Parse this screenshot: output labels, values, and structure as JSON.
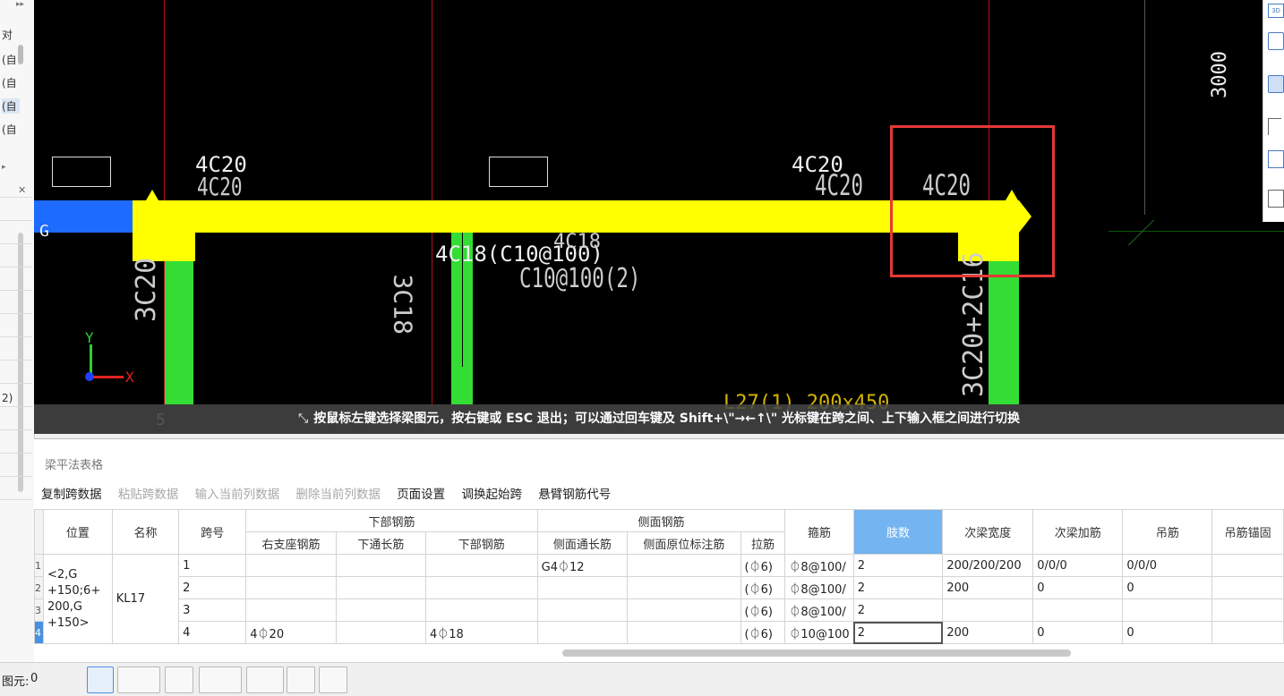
{
  "left_panel": {
    "items": [
      "对",
      "(自",
      "(自",
      "(自",
      "(自"
    ],
    "side_label": "2)"
  },
  "cad": {
    "labels": {
      "top_left_4c20": "4C20",
      "top_left_4c20_b": "4C20",
      "top_mid_4c20": "4C20",
      "top_mid_4c20_b": "4C20",
      "highlight_4c20": "4C20",
      "col_left": "3C20",
      "mid_stirrup": "4C18(C10@100)",
      "mid_4c18": "4C18",
      "mid_c10": "C10@100(2)",
      "mid_3c18": "3C18",
      "col_right": "3C20+2C16",
      "dim_3000": "3000",
      "axis_g": "G",
      "axis_5": "5",
      "bottom_partial": "L27(1) 200x450",
      "axis_x": "X",
      "axis_y": "Y"
    },
    "hint": "按鼠标左键选择梁图元，按右键或 ESC 退出；可以通过回车键及 Shift+\\\"→←↑\\\" 光标键在跨之间、上下输入框之间进行切换",
    "highlight_color": "#e53935",
    "beam_color": "#ffff00",
    "column_color": "#33dd33"
  },
  "panel": {
    "title": "梁平法表格",
    "toolbar": [
      {
        "label": "复制跨数据",
        "enabled": true
      },
      {
        "label": "粘贴跨数据",
        "enabled": false
      },
      {
        "label": "输入当前列数据",
        "enabled": false
      },
      {
        "label": "删除当前列数据",
        "enabled": false
      },
      {
        "label": "页面设置",
        "enabled": true
      },
      {
        "label": "调换起始跨",
        "enabled": true
      },
      {
        "label": "悬臂钢筋代号",
        "enabled": true
      }
    ],
    "groups": {
      "bottom": "下部钢筋",
      "side": "侧面钢筋"
    },
    "headers": {
      "position": "位置",
      "name": "名称",
      "span": "跨号",
      "right_support": "右支座钢筋",
      "bottom_through": "下通长筋",
      "bottom_rebar": "下部钢筋",
      "side_through": "侧面通长筋",
      "side_note": "侧面原位标注筋",
      "tie": "拉筋",
      "stirrup": "箍筋",
      "legs": "肢数",
      "sec_width": "次梁宽度",
      "sec_add": "次梁加筋",
      "hanger": "吊筋",
      "hanger_anchor": "吊筋锚固"
    },
    "position_value": "<2,G +150;6+ 200,G +150>",
    "name_value": "KL17",
    "rows": [
      {
        "rn": "1",
        "span": "1",
        "right_support": "",
        "bottom_rebar": "",
        "side_through": "G4⏀12",
        "tie": "(⏀6)",
        "stirrup": "⏀8@100/",
        "legs": "2",
        "sec_width": "200/200/200",
        "sec_add": "0/0/0",
        "hanger": "0/0/0"
      },
      {
        "rn": "2",
        "span": "2",
        "right_support": "",
        "bottom_rebar": "",
        "side_through": "",
        "tie": "(⏀6)",
        "stirrup": "⏀8@100/",
        "legs": "2",
        "sec_width": "200",
        "sec_add": "0",
        "hanger": "0"
      },
      {
        "rn": "3",
        "span": "3",
        "right_support": "",
        "bottom_rebar": "",
        "side_through": "",
        "tie": "(⏀6)",
        "stirrup": "⏀8@100/",
        "legs": "2",
        "sec_width": "",
        "sec_add": "",
        "hanger": ""
      },
      {
        "rn": "4",
        "span": "4",
        "right_support": "4⏀20",
        "bottom_rebar": "4⏀18",
        "side_through": "",
        "tie": "(⏀6)",
        "stirrup": "⏀10@100",
        "legs": "2",
        "sec_width": "200",
        "sec_add": "0",
        "hanger": "0"
      }
    ]
  },
  "status": {
    "label": "图元:",
    "value": "0"
  }
}
